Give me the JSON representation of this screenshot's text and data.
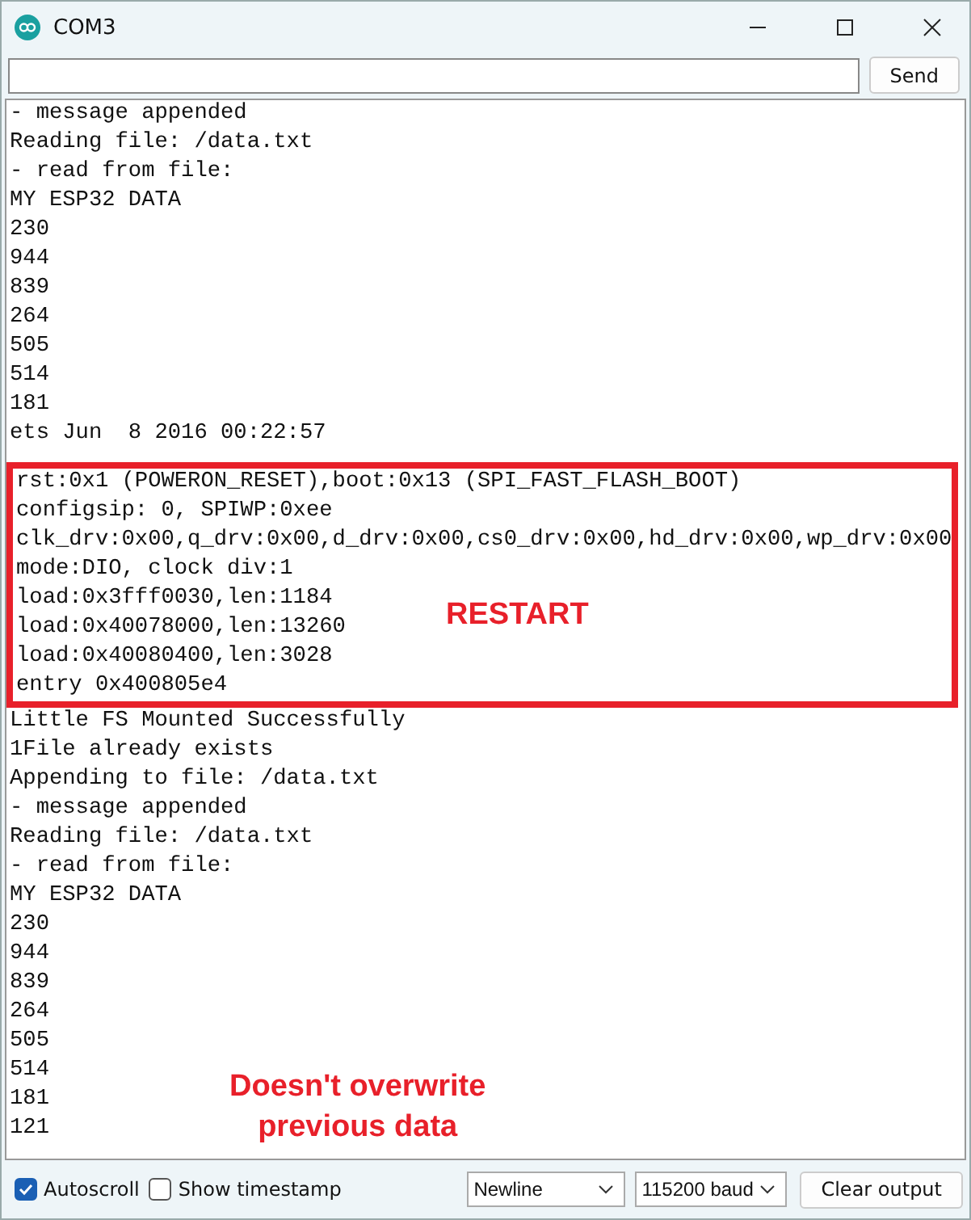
{
  "window": {
    "title": "COM3"
  },
  "input": {
    "button": "Send"
  },
  "log": {
    "before": [
      "- message appended",
      "Reading file: /data.txt",
      "- read from file:",
      "MY ESP32 DATA",
      "230",
      "944",
      "839",
      "264",
      "505",
      "514",
      "181",
      "ets Jun  8 2016 00:22:57"
    ],
    "highlighted": {
      "lines": [
        "rst:0x1 (POWERON_RESET),boot:0x13 (SPI_FAST_FLASH_BOOT)",
        "configsip: 0, SPIWP:0xee",
        "clk_drv:0x00,q_drv:0x00,d_drv:0x00,cs0_drv:0x00,hd_drv:0x00,wp_drv:0x00",
        "mode:DIO, clock div:1",
        "load:0x3fff0030,len:1184",
        "load:0x40078000,len:13260",
        "load:0x40080400,len:3028",
        "entry 0x400805e4"
      ],
      "annotation": "RESTART"
    },
    "after": [
      "Little FS Mounted Successfully",
      "1File already exists",
      "Appending to file: /data.txt",
      "- message appended",
      "Reading file: /data.txt",
      "- read from file:",
      "MY ESP32 DATA",
      "230",
      "944",
      "839",
      "264",
      "505",
      "514",
      "181",
      "121"
    ],
    "annotation": [
      "Doesn't overwrite",
      "previous data"
    ]
  },
  "footer": {
    "checkboxes": [
      {
        "label": "Autoscroll",
        "checked": true
      },
      {
        "label": "Show timestamp",
        "checked": false
      }
    ],
    "dropdowns": [
      "Newline",
      "115200 baud"
    ],
    "button": "Clear output"
  }
}
